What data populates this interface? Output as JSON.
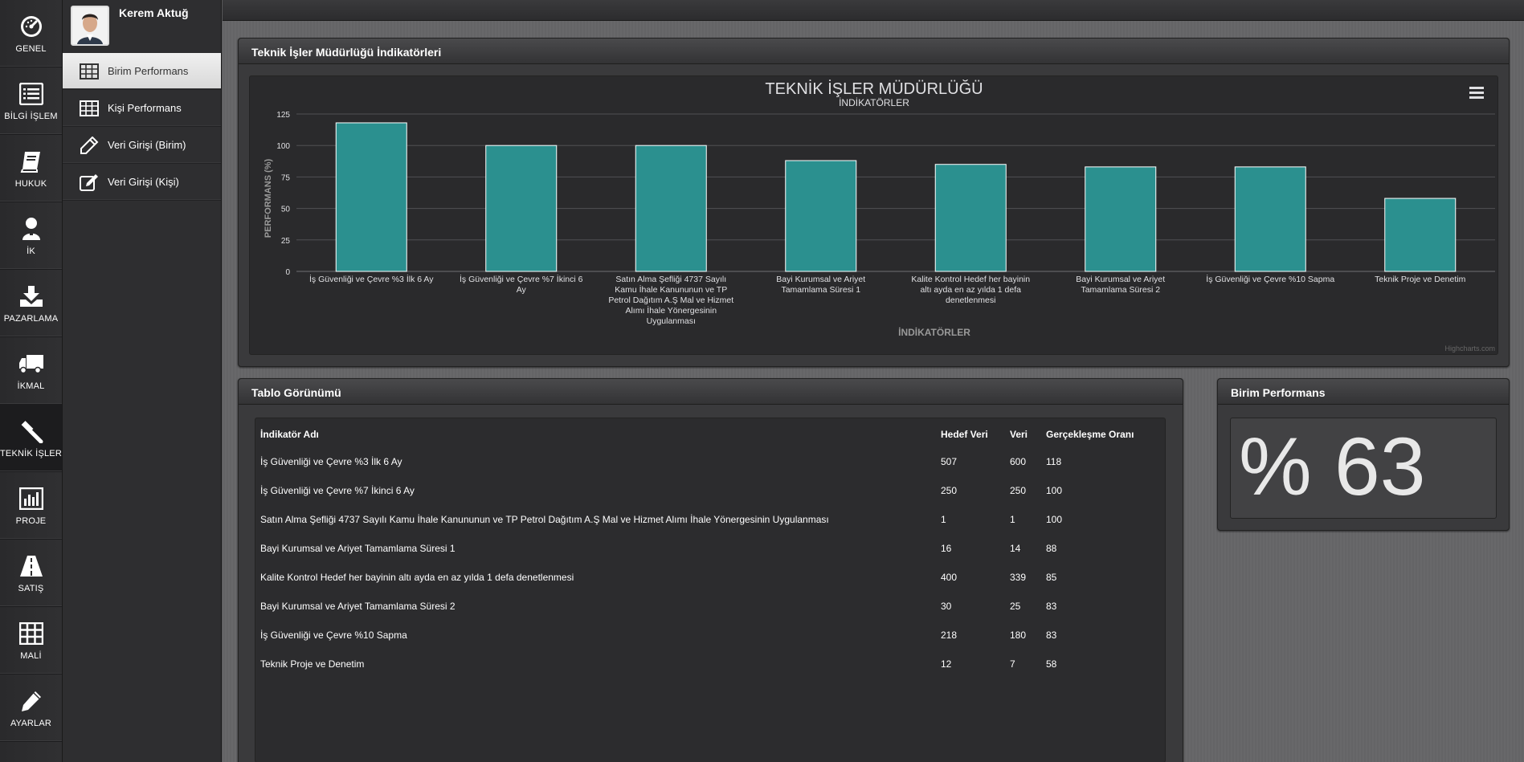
{
  "nav": [
    {
      "label": "GENEL",
      "icon": "gauge-icon"
    },
    {
      "label": "BİLGİ İŞLEM",
      "icon": "list-icon"
    },
    {
      "label": "HUKUK",
      "icon": "book-icon"
    },
    {
      "label": "İK",
      "icon": "person-icon"
    },
    {
      "label": "PAZARLAMA",
      "icon": "download-icon"
    },
    {
      "label": "İKMAL",
      "icon": "truck-icon"
    },
    {
      "label": "TEKNİK İŞLER",
      "icon": "gavel-icon"
    },
    {
      "label": "PROJE",
      "icon": "bar-chart-icon"
    },
    {
      "label": "SATIŞ",
      "icon": "road-icon"
    },
    {
      "label": "MALİ",
      "icon": "grid-icon"
    },
    {
      "label": "AYARLAR",
      "icon": "pencil-icon"
    }
  ],
  "user": {
    "name": "Kerem Aktuğ"
  },
  "subnav": [
    {
      "label": "Birim Performans",
      "icon": "table-icon"
    },
    {
      "label": "Kişi Performans",
      "icon": "table-icon"
    },
    {
      "label": "Veri Girişi (Birim)",
      "icon": "pencil-icon"
    },
    {
      "label": "Veri Girişi (Kişi)",
      "icon": "edit-icon"
    }
  ],
  "chart_panel": {
    "title": "Teknik İşler Müdürlüğü İndikatörleri",
    "credit": "Highcharts.com"
  },
  "chart_data": {
    "type": "bar",
    "title": "TEKNİK İŞLER MÜDÜRLÜĞÜ",
    "subtitle": "İNDİKATÖRLER",
    "xlabel": "İNDİKATÖRLER",
    "ylabel": "PERFORMANS (%)",
    "ylim": [
      0,
      125
    ],
    "yticks": [
      0,
      25,
      50,
      75,
      100,
      125
    ],
    "grid": true,
    "color": "#2b908f",
    "categories": [
      "İş Güvenliği ve Çevre %3 İlk 6 Ay",
      "İş Güvenliği ve Çevre %7 İkinci 6 Ay",
      "Satın Alma Şefliği 4737 Sayılı Kamu İhale Kanununun ve TP Petrol Dağıtım A.Ş Mal ve Hizmet Alımı İhale Yönergesinin Uygulanması",
      "Bayi Kurumsal ve Ariyet Tamamlama Süresi 1",
      "Kalite Kontrol Hedef her bayinin altı ayda en az yılda 1 defa denetlenmesi",
      "Bayi Kurumsal ve Ariyet Tamamlama Süresi 2",
      "İş Güvenliği ve Çevre %10 Sapma",
      "Teknik Proje ve Denetim"
    ],
    "values": [
      118,
      100,
      100,
      88,
      85,
      83,
      83,
      58
    ]
  },
  "table_panel": {
    "title": "Tablo Görünümü",
    "headers": [
      "İndikatör Adı",
      "Hedef Veri",
      "Veri",
      "Gerçekleşme Oranı"
    ],
    "rows": [
      [
        "İş Güvenliği ve Çevre %3 İlk 6 Ay",
        "507",
        "600",
        "118"
      ],
      [
        "İş Güvenliği ve Çevre %7 İkinci 6 Ay",
        "250",
        "250",
        "100"
      ],
      [
        "Satın Alma Şefliği 4737 Sayılı Kamu İhale Kanununun ve TP Petrol Dağıtım A.Ş Mal ve Hizmet Alımı İhale Yönergesinin Uygulanması",
        "1",
        "1",
        "100"
      ],
      [
        "Bayi Kurumsal ve Ariyet Tamamlama Süresi 1",
        "16",
        "14",
        "88"
      ],
      [
        "Kalite Kontrol Hedef her bayinin altı ayda en az yılda 1 defa denetlenmesi",
        "400",
        "339",
        "85"
      ],
      [
        "Bayi Kurumsal ve Ariyet Tamamlama Süresi 2",
        "30",
        "25",
        "83"
      ],
      [
        "İş Güvenliği ve Çevre %10 Sapma",
        "218",
        "180",
        "83"
      ],
      [
        "Teknik Proje ve Denetim",
        "12",
        "7",
        "58"
      ]
    ]
  },
  "perf_panel": {
    "title": "Birim Performans",
    "value": "% 63"
  }
}
